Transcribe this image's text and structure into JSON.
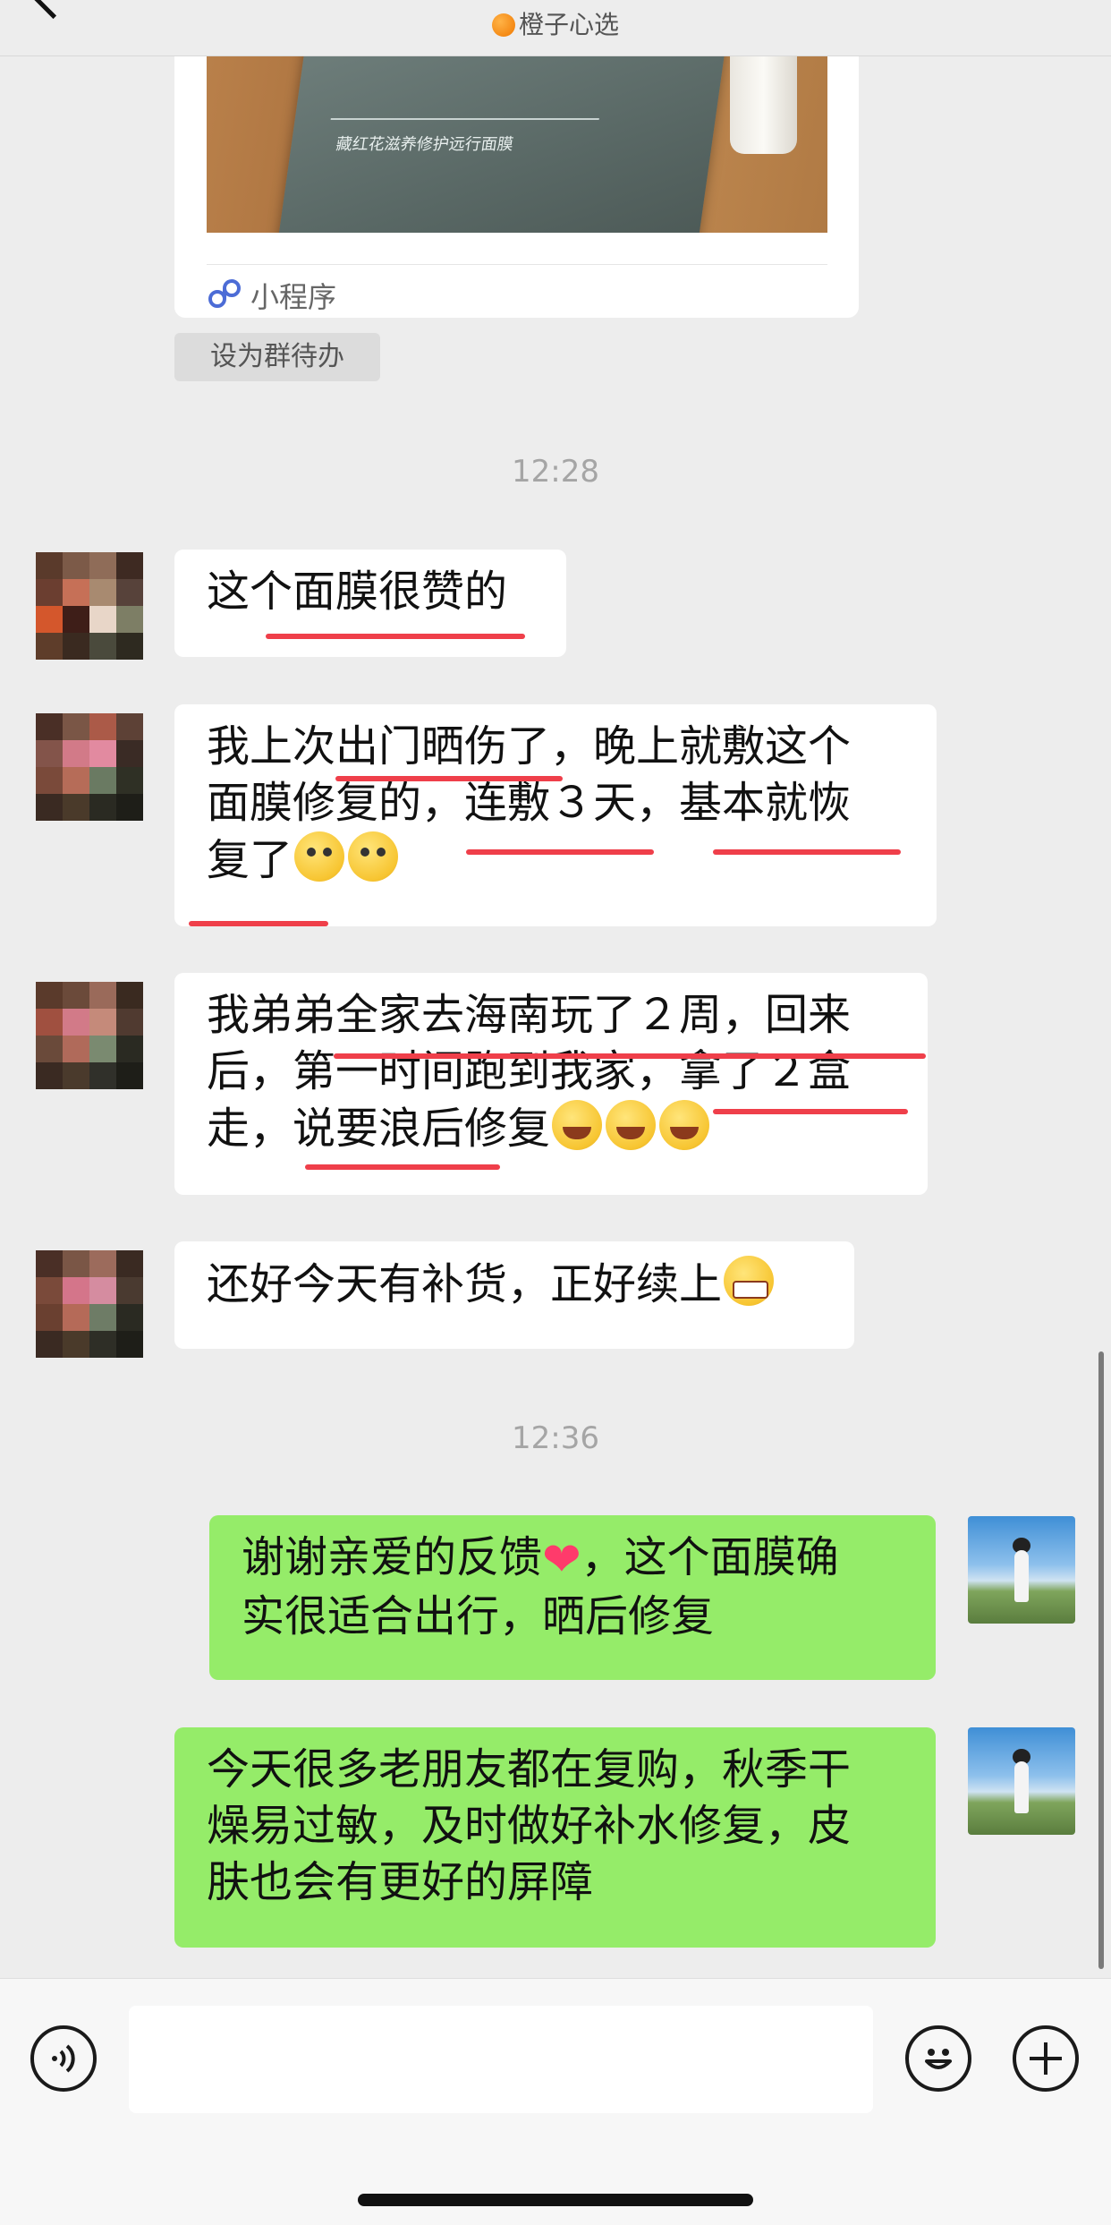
{
  "header": {
    "title": "",
    "subtitle": "橙子心选",
    "subtitle_icon": "orange-icon"
  },
  "shared_card": {
    "image_text": "藏红花滋养修护远行面膜",
    "image_small_text": "",
    "app_label": "小程序",
    "app_icon": "mini-program-icon"
  },
  "todo_tag": "设为群待办",
  "times": [
    "12:28",
    "12:36"
  ],
  "messages": [
    {
      "side": "left",
      "text": "这个面膜很赞的"
    },
    {
      "side": "left",
      "line1": "我上次出门晒伤了，晚上就敷这个",
      "line2": "面膜修复的，连敷３天，基本就恢",
      "line3": "复了",
      "emoji": "pleading-face-emoji"
    },
    {
      "side": "left",
      "line1": "我弟弟全家去海南玩了２周，回来",
      "line2": "后，第一时间跑到我家，拿了２盒",
      "line3": "走，说要浪后修复",
      "emoji": "laughing-tears-emoji"
    },
    {
      "side": "left",
      "text": "还好今天有补货，正好续上",
      "emoji": "grinning-face-emoji"
    },
    {
      "side": "right",
      "line1a": "谢谢亲爱的反馈",
      "line1b": "，这个面膜确",
      "line2": "实很适合出行，晒后修复",
      "emoji": "heart-emoji"
    },
    {
      "side": "right",
      "line1": "今天很多老朋友都在复购，秋季干",
      "line2": "燥易过敏，及时做好补水修复，皮",
      "line3": "肤也会有更好的屏障"
    }
  ],
  "input_bar": {
    "voice_icon": "voice-icon",
    "emoji_icon": "emoji-icon",
    "plus_icon": "plus-icon",
    "placeholder": ""
  },
  "colors": {
    "background": "#ededed",
    "incoming_bubble": "#ffffff",
    "outgoing_bubble": "#95ec69",
    "underline_mark": "#ef3f4a"
  }
}
